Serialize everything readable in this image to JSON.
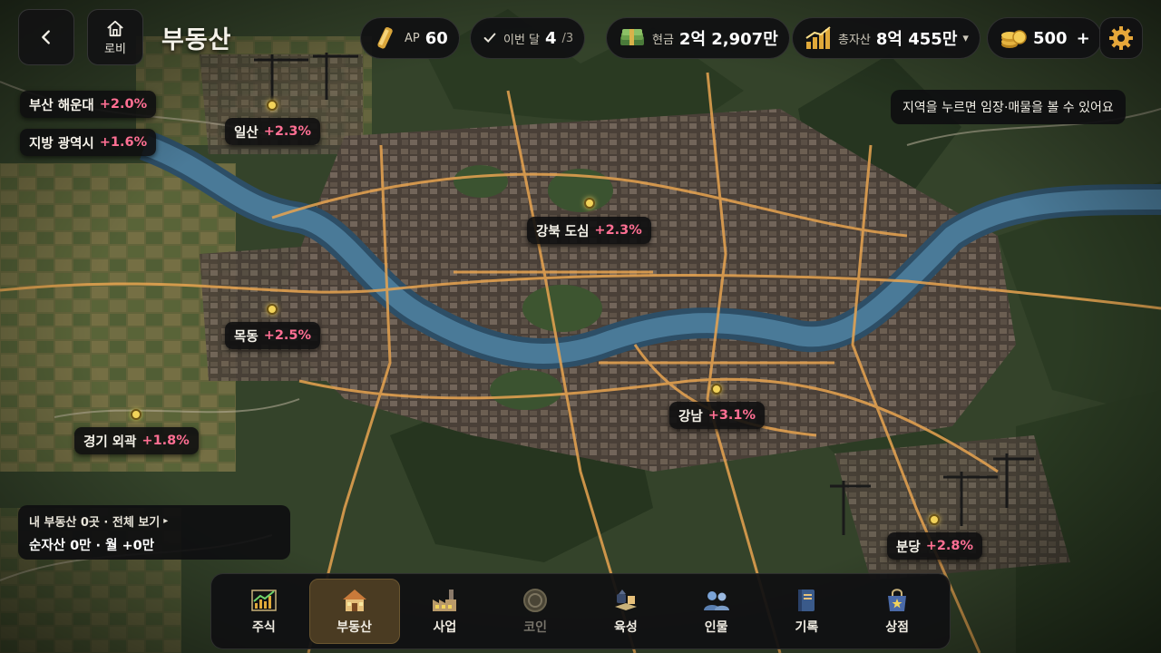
{
  "header": {
    "back_label": "back",
    "lobby_label": "로비",
    "title": "부동산"
  },
  "stats": {
    "ap_label": "AP",
    "ap_value": "60",
    "month_label": "이번 달",
    "month_value": "4",
    "month_total": "/3",
    "cash_label": "현금",
    "cash_value": "2억 2,907만",
    "assets_label": "총자산",
    "assets_value": "8억 455만",
    "assets_dropdown": "▾",
    "coins_value": "500",
    "coins_add": "+"
  },
  "hint": "지역을 누르면 임장·매물을 볼 수 있어요",
  "regions": [
    {
      "id": "busan",
      "name": "부산 해운대",
      "change": "+2.0%"
    },
    {
      "id": "metro",
      "name": "지방 광역시",
      "change": "+1.6%"
    },
    {
      "id": "ilsan",
      "name": "일산",
      "change": "+2.3%"
    },
    {
      "id": "gangbuk",
      "name": "강북 도심",
      "change": "+2.3%"
    },
    {
      "id": "mokdong",
      "name": "목동",
      "change": "+2.5%"
    },
    {
      "id": "gangnam",
      "name": "강남",
      "change": "+3.1%"
    },
    {
      "id": "gyeonggi",
      "name": "경기 외곽",
      "change": "+1.8%"
    },
    {
      "id": "bundang",
      "name": "분당",
      "change": "+2.8%"
    }
  ],
  "my_properties": {
    "title": "내 부동산 0곳 · 전체 보기",
    "arrow": "▸",
    "summary": "순자산 0만 · 월 +0만"
  },
  "nav": [
    {
      "label": "주식",
      "icon": "stock-chart-icon",
      "active": false,
      "disabled": false
    },
    {
      "label": "부동산",
      "icon": "house-icon",
      "active": true,
      "disabled": false
    },
    {
      "label": "사업",
      "icon": "factory-icon",
      "active": false,
      "disabled": false
    },
    {
      "label": "코인",
      "icon": "coin-icon",
      "active": false,
      "disabled": true
    },
    {
      "label": "육성",
      "icon": "growth-icon",
      "active": false,
      "disabled": false
    },
    {
      "label": "인물",
      "icon": "people-icon",
      "active": false,
      "disabled": false
    },
    {
      "label": "기록",
      "icon": "book-icon",
      "active": false,
      "disabled": false
    },
    {
      "label": "상점",
      "icon": "shop-bag-icon",
      "active": false,
      "disabled": false
    }
  ],
  "colors": {
    "accent_gold": "#f2c14e",
    "change_pink": "#ff6f93",
    "river": "#3d6a8a",
    "road": "#e8a450"
  }
}
